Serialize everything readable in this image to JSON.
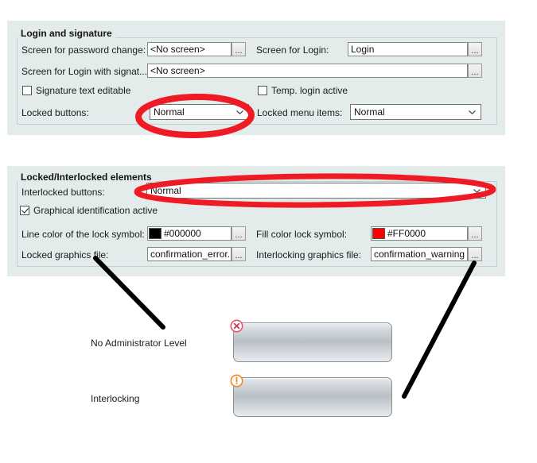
{
  "window": {
    "background_color": "#ffffff",
    "panel_background_color": "#e4ebeb"
  },
  "panels": [
    {
      "title": "Login and signature",
      "rows": [
        {
          "label": "Screen for password change:",
          "value": "<No screen>",
          "browse_label": "...",
          "label2": "Screen for Login:",
          "value2": "Login",
          "browse_label2": "..."
        },
        {
          "label": "Screen for Login with signat...",
          "value": "<No screen>",
          "browse_label": "..."
        }
      ],
      "checkboxes": [
        {
          "label": "Signature text editable",
          "checked": false
        },
        {
          "label": "Temp. login active",
          "checked": false
        }
      ],
      "combos": [
        {
          "label": "Locked buttons:",
          "value": "Normal"
        },
        {
          "label": "Locked menu items:",
          "value": "Normal"
        }
      ]
    },
    {
      "title": "Locked/Interlocked elements",
      "combos": [
        {
          "label": "Interlocked buttons:",
          "value": "Normal"
        }
      ],
      "checkboxes": [
        {
          "label": "Graphical identification active",
          "checked": true
        }
      ],
      "colors": [
        {
          "label": "Line color of the lock symbol:",
          "value": "#000000",
          "swatch": "#000000",
          "browse_label": "..."
        },
        {
          "label": "Fill color lock symbol:",
          "value": "#FF0000",
          "swatch": "#FF0000",
          "browse_label": "..."
        }
      ],
      "files": [
        {
          "label": "Locked graphics file:",
          "value": "confirmation_error.",
          "browse_label": "..."
        },
        {
          "label": "Interlocking graphics file:",
          "value": "confirmation_warning",
          "browse_label": "..."
        }
      ]
    }
  ],
  "preview": {
    "items": [
      {
        "caption": "No Administrator Level",
        "icon": "error-circle-x-icon",
        "icon_color": "#e0566a"
      },
      {
        "caption": "Interlocking",
        "icon": "warning-circle-exclamation-icon",
        "icon_color": "#ef8a22"
      }
    ]
  },
  "annotations": {
    "highlight_color": "#ee1b24",
    "pointer_color": "#000000",
    "highlights": [
      {
        "target": "locked-buttons-combo"
      },
      {
        "target": "interlocked-buttons-combo"
      }
    ],
    "pointers": [
      {
        "from": "locked-graphics-file-field",
        "to": "preview-no-administrator-level"
      },
      {
        "from": "interlocking-graphics-file-field",
        "to": "preview-interlocking"
      }
    ]
  }
}
